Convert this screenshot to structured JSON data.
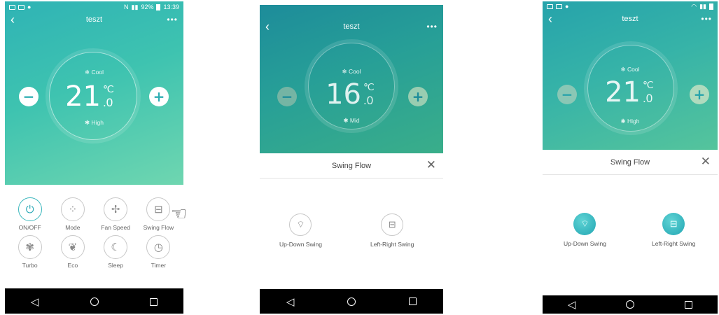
{
  "status_time": "13:39",
  "status_battery": "92%",
  "app_title": "teszt",
  "screens": [
    {
      "mode": "Cool",
      "temp_int": "21",
      "temp_unit": "℃",
      "temp_dec": ".0",
      "fan": "High"
    },
    {
      "mode": "Cool",
      "temp_int": "16",
      "temp_unit": "℃",
      "temp_dec": ".0",
      "fan": "Mid"
    },
    {
      "mode": "Cool",
      "temp_int": "21",
      "temp_unit": "℃",
      "temp_dec": ".0",
      "fan": "High"
    }
  ],
  "controls": [
    {
      "label": "ON/OFF",
      "icon": "power-icon",
      "glyph": "⏻"
    },
    {
      "label": "Mode",
      "icon": "mode-icon",
      "glyph": "⁘"
    },
    {
      "label": "Fan Speed",
      "icon": "fan-speed-icon",
      "glyph": "✢"
    },
    {
      "label": "Swing Flow",
      "icon": "swing-flow-icon",
      "glyph": "⊟"
    },
    {
      "label": "Turbo",
      "icon": "turbo-icon",
      "glyph": "✾"
    },
    {
      "label": "Eco",
      "icon": "eco-icon",
      "glyph": "❦"
    },
    {
      "label": "Sleep",
      "icon": "sleep-icon",
      "glyph": "☾"
    },
    {
      "label": "Timer",
      "icon": "timer-icon",
      "glyph": "◷"
    }
  ],
  "swing_sheet": {
    "title": "Swing Flow",
    "up_down_label": "Up-Down Swing",
    "left_right_label": "Left-Right Swing"
  },
  "colors": {
    "accent": "#39b6bc",
    "active_swing": "#22a6b3",
    "navbar": "#000000"
  }
}
